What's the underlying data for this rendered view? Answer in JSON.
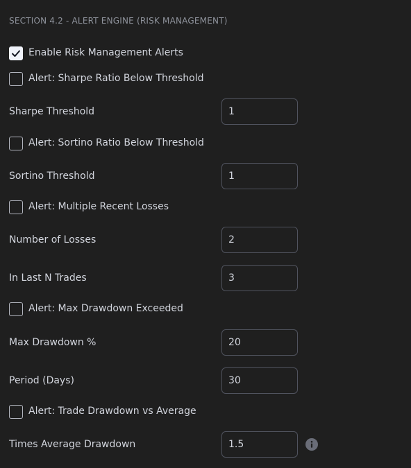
{
  "section": {
    "title": "SECTION 4.2 - ALERT ENGINE (RISK MANAGEMENT)"
  },
  "enable_alerts": {
    "label": "Enable Risk Management Alerts",
    "checked": true
  },
  "sharpe": {
    "check_label": "Alert: Sharpe Ratio Below Threshold",
    "checked": false,
    "threshold_label": "Sharpe Threshold",
    "threshold_value": "1"
  },
  "sortino": {
    "check_label": "Alert: Sortino Ratio Below Threshold",
    "checked": false,
    "threshold_label": "Sortino Threshold",
    "threshold_value": "1"
  },
  "losses": {
    "check_label": "Alert: Multiple Recent Losses",
    "checked": false,
    "count_label": "Number of Losses",
    "count_value": "2",
    "trades_label": "In Last N Trades",
    "trades_value": "3"
  },
  "max_drawdown": {
    "check_label": "Alert: Max Drawdown Exceeded",
    "checked": false,
    "percent_label": "Max Drawdown %",
    "percent_value": "20",
    "period_label": "Period (Days)",
    "period_value": "30"
  },
  "trade_drawdown": {
    "check_label": "Alert: Trade Drawdown vs Average",
    "checked": false,
    "times_label": "Times Average Drawdown",
    "times_value": "1.5",
    "info_icon": "info-icon"
  },
  "colors": {
    "background": "#1f1f1f",
    "text": "#d1d4dc",
    "header_text": "#8f939c",
    "input_border": "#50535e",
    "checkbox_checked_bg": "#f0f3fa"
  }
}
